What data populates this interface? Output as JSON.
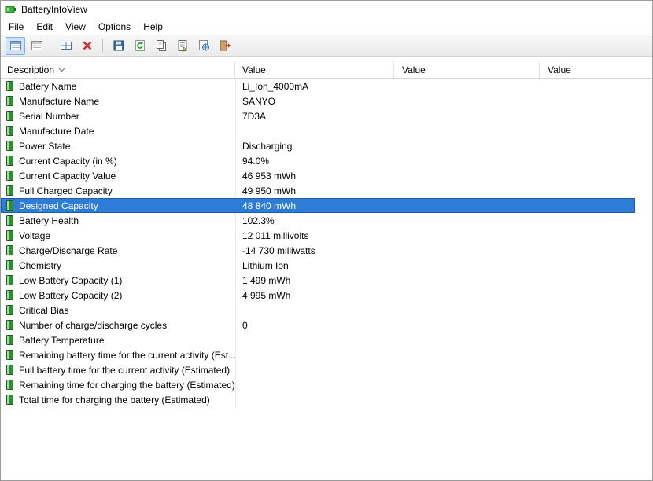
{
  "window": {
    "title": "BatteryInfoView"
  },
  "menu": {
    "items": [
      "File",
      "Edit",
      "View",
      "Options",
      "Help"
    ]
  },
  "toolbar": {
    "buttons": [
      {
        "icon": "battery-info-view-icon",
        "pressed": true
      },
      {
        "icon": "battery-log-view-icon",
        "pressed": false
      },
      {
        "icon": "choose-columns-icon",
        "pressed": false
      },
      {
        "icon": "delete-icon",
        "pressed": false
      },
      {
        "icon": "save-icon",
        "pressed": false
      },
      {
        "icon": "refresh-icon",
        "pressed": false
      },
      {
        "icon": "copy-icon",
        "pressed": false
      },
      {
        "icon": "properties-icon",
        "pressed": false
      },
      {
        "icon": "html-report-icon",
        "pressed": false
      },
      {
        "icon": "exit-icon",
        "pressed": false
      }
    ]
  },
  "table": {
    "columns": [
      "Description",
      "Value",
      "Value",
      "Value"
    ],
    "sort_column": "Description",
    "selected_index": 8,
    "rows": [
      {
        "description": "Battery Name",
        "value": "Li_Ion_4000mA"
      },
      {
        "description": "Manufacture Name",
        "value": "SANYO"
      },
      {
        "description": "Serial Number",
        "value": "7D3A"
      },
      {
        "description": "Manufacture Date",
        "value": ""
      },
      {
        "description": "Power State",
        "value": "Discharging"
      },
      {
        "description": "Current Capacity (in %)",
        "value": "94.0%"
      },
      {
        "description": "Current Capacity Value",
        "value": "46 953 mWh"
      },
      {
        "description": "Full Charged Capacity",
        "value": "49 950 mWh"
      },
      {
        "description": "Designed Capacity",
        "value": "48 840 mWh"
      },
      {
        "description": "Battery Health",
        "value": "102.3%"
      },
      {
        "description": "Voltage",
        "value": "12 011 millivolts"
      },
      {
        "description": "Charge/Discharge Rate",
        "value": "-14 730 milliwatts"
      },
      {
        "description": "Chemistry",
        "value": "Lithium Ion"
      },
      {
        "description": "Low Battery Capacity (1)",
        "value": "1 499 mWh"
      },
      {
        "description": "Low Battery Capacity (2)",
        "value": "4 995 mWh"
      },
      {
        "description": "Critical Bias",
        "value": ""
      },
      {
        "description": "Number of charge/discharge cycles",
        "value": "0"
      },
      {
        "description": "Battery Temperature",
        "value": ""
      },
      {
        "description": "Remaining battery time for the current activity (Est...",
        "value": ""
      },
      {
        "description": "Full battery time for the current activity (Estimated)",
        "value": ""
      },
      {
        "description": "Remaining time for charging the battery (Estimated)",
        "value": ""
      },
      {
        "description": "Total  time for charging the battery (Estimated)",
        "value": ""
      }
    ]
  },
  "colors": {
    "selection_bg": "#2e7cd6",
    "selection_border": "#1b5cad",
    "battery_green": "#2f8f2f",
    "delete_red": "#cc3333"
  }
}
